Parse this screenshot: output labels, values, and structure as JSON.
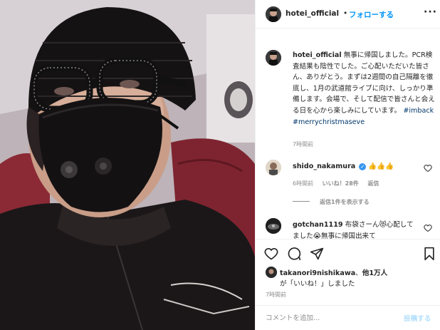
{
  "post": {
    "username": "hotei_official",
    "dot": "•",
    "follow_label": "フォローする",
    "more_label": "···"
  },
  "caption": {
    "username": "hotei_official",
    "text": "無事に帰国しました。PCR検査結果も陰性でした。ご心配いただいた皆さん、ありがとう。まずは2週間の自己隔離を徹底し、1月の武道館ライブに向け、しっかり準備します。会場で、そして配信で皆さんと会える日を心から楽しみにしています。",
    "hashtags": "#imback #merrychristmaseve",
    "time": "7時間前"
  },
  "comments": [
    {
      "username": "shido_nakamura",
      "verified_glyph": "✓",
      "text": "👍👍👍",
      "time": "6時間前",
      "likes": "いいね！28件",
      "reply_label": "返信",
      "replies_label": "返信1件を表示する"
    },
    {
      "username": "gotchan1119",
      "text": "布袋さーん😻心配してました😭無事に帰国出来て"
    }
  ],
  "likes": {
    "user": "takanori9nishikawa",
    "separator": "、",
    "others": "他1万人",
    "suffix": "が「いいね！」しました"
  },
  "post_time": "7時間前",
  "add_comment": {
    "placeholder": "コメントを追加...",
    "post_label": "投稿する"
  },
  "colors": {
    "accent": "#0095f6",
    "link": "#00376b",
    "muted": "#8e8e8e",
    "post_disabled": "#b2dffc"
  },
  "icons": {
    "like": "heart-icon",
    "comment": "comment-icon",
    "share": "paper-plane-icon",
    "save": "bookmark-icon"
  }
}
